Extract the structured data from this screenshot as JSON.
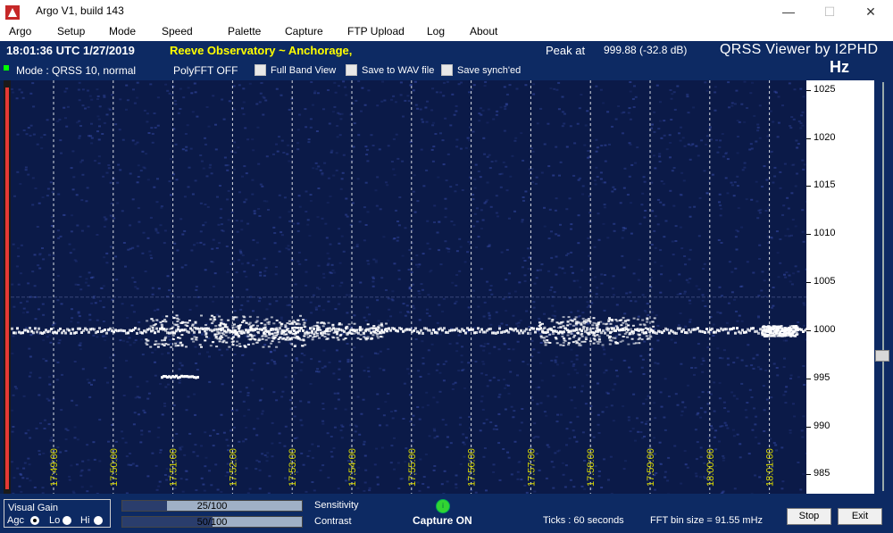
{
  "window": {
    "title": "Argo V1, build 143",
    "controls": {
      "minimize": "—",
      "maximize": "☐",
      "close": "✕"
    }
  },
  "menu": [
    "Argo",
    "Setup",
    "Mode",
    "Speed",
    "Palette",
    "Capture",
    "FTP Upload",
    "Log",
    "About"
  ],
  "info": {
    "time": "18:01:36 UTC  1/27/2019",
    "station": "Reeve Observatory ~ Anchorage,",
    "peak_label": "Peak at",
    "peak_value": "999.88 (-32.8 dB)",
    "viewer_title": "QRSS Viewer by I2PHD",
    "hz": "Hz",
    "mode": "Mode : QRSS 10, normal",
    "polyfft": "PolyFFT OFF",
    "options": [
      "Full Band View",
      "Save to WAV file",
      "Save synch'ed"
    ]
  },
  "waterfall": {
    "time_labels": [
      "17:49:00",
      "17:50:00",
      "17:51:00",
      "17:52:00",
      "17:53:00",
      "17:54:00",
      "17:55:00",
      "17:56:00",
      "17:57:00",
      "17:58:00",
      "17:59:00",
      "18:00:00",
      "18:01:00"
    ],
    "freq_labels": [
      "1025",
      "1020",
      "1015",
      "1010",
      "1005",
      "1000",
      "995",
      "990",
      "985"
    ],
    "freq_min": 983,
    "freq_max": 1026,
    "signal_freq": 1000,
    "colors": {
      "background": "#0b1a48",
      "signal": "#ffffff",
      "noise": "#3a4fb0",
      "grid": "#ffffff",
      "time_label": "#d8d800"
    }
  },
  "bottom": {
    "gain_title": "Visual Gain",
    "gain_options": [
      {
        "label": "Agc",
        "selected": true
      },
      {
        "label": "Lo",
        "selected": false
      },
      {
        "label": "Hi",
        "selected": false
      }
    ],
    "sensitivity": {
      "value": "25/100",
      "fraction": 0.25,
      "label": "Sensitivity"
    },
    "contrast": {
      "value": "50/100",
      "fraction": 0.5,
      "label": "Contrast"
    },
    "capture_led": "i",
    "capture": "Capture ON",
    "ticks": "Ticks  : 60 seconds",
    "fft_bin": "FFT bin size = 91.55 mHz",
    "stop": "Stop",
    "exit": "Exit"
  }
}
